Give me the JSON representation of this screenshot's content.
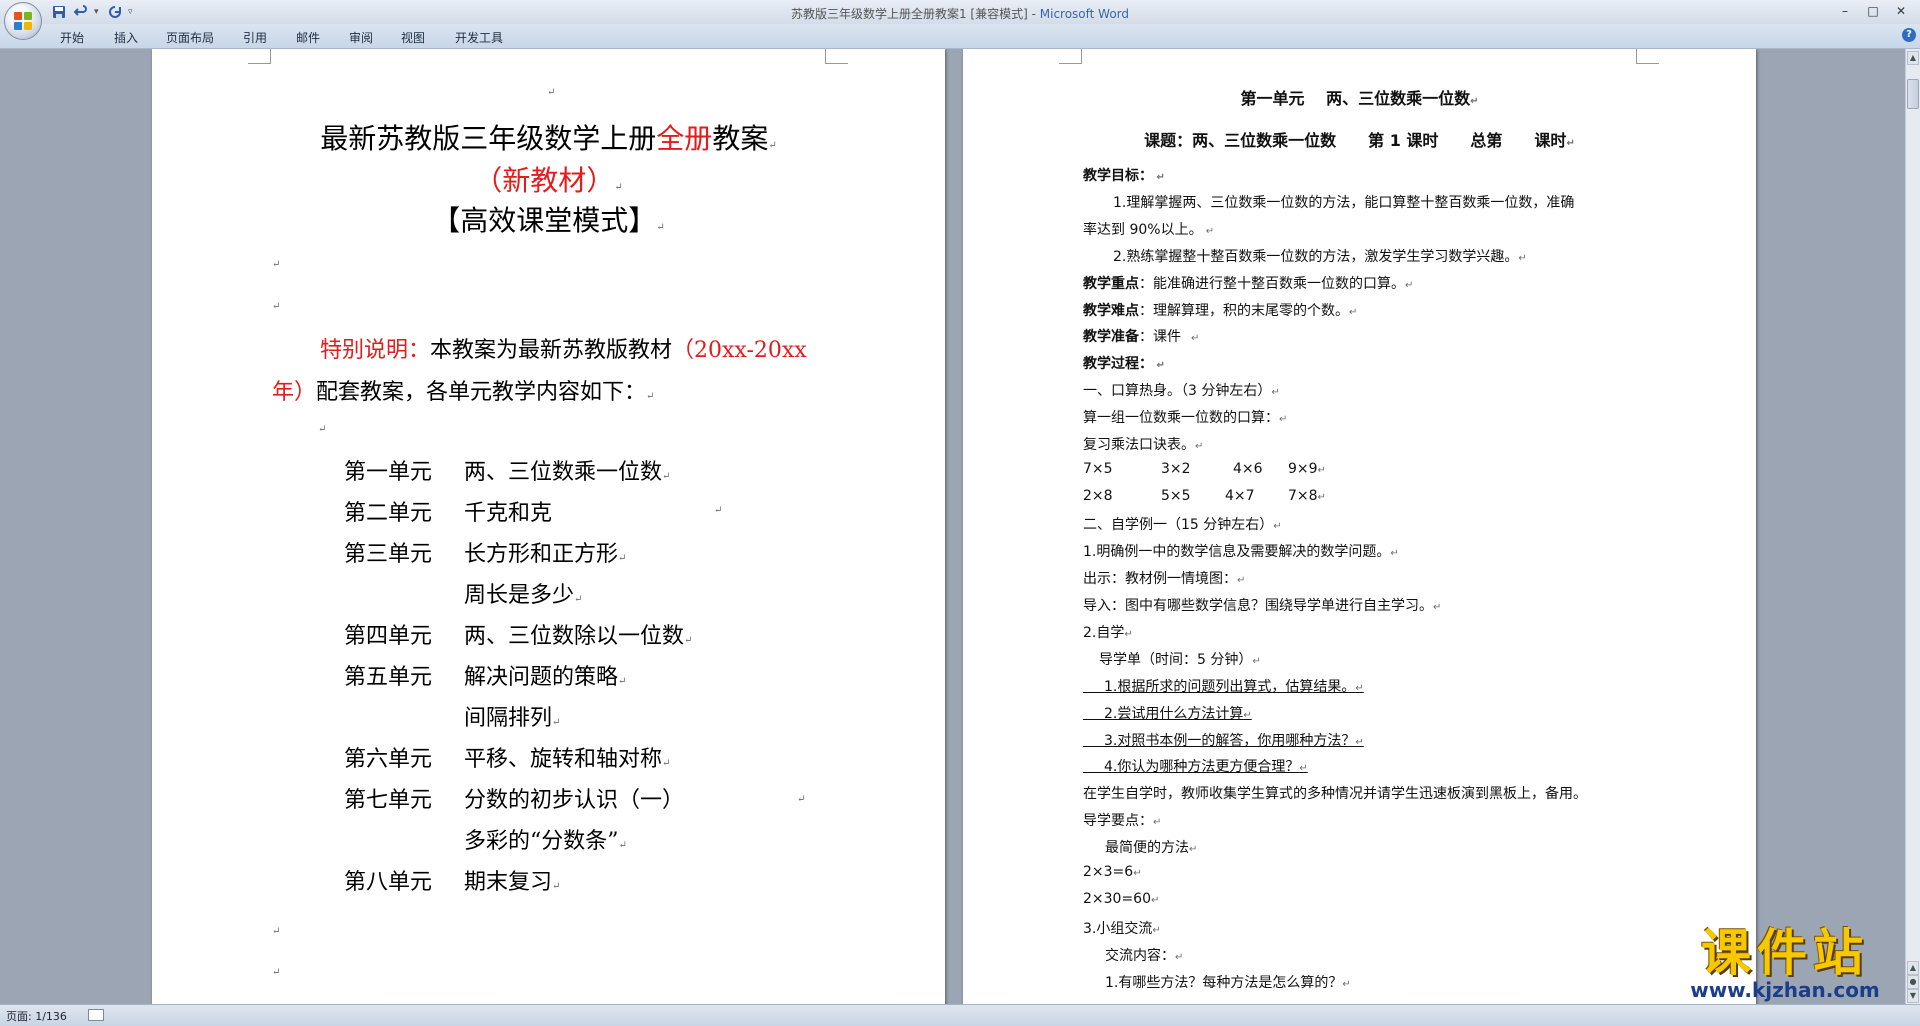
{
  "window": {
    "title_doc": "苏教版三年级数学上册全册教案1 [兼容模式] - ",
    "title_app": "Microsoft Word",
    "minimize": "–",
    "maximize": "□",
    "close": "✕"
  },
  "qat": {
    "save_icon": "save-icon",
    "undo_icon": "undo-icon",
    "redo_icon": "redo-icon",
    "customize_icon": "customize-icon"
  },
  "ribbon": {
    "tabs": [
      "开始",
      "插入",
      "页面布局",
      "引用",
      "邮件",
      "审阅",
      "视图",
      "开发工具"
    ]
  },
  "page1": {
    "title_a": "最新苏教版三年级数学上册",
    "title_red": "全册",
    "title_b": "教案",
    "subtitle_open": "（",
    "subtitle": "新教材",
    "subtitle_close": "）",
    "mode": "【高效课堂模式】",
    "note_label": "特别说明：",
    "note_text": "本教案为最新苏教版教材",
    "note_years": "（20xx-20xx",
    "note_years2": "年）",
    "note_text2": "配套教案，各单元教学内容如下：",
    "units": [
      {
        "no": "第一单元",
        "topic": "两、三位数乘一位数"
      },
      {
        "no": "第二单元",
        "topic": "千克和克"
      },
      {
        "no": "第三单元",
        "topic": "长方形和正方形"
      },
      {
        "no": "",
        "topic": "周长是多少"
      },
      {
        "no": "第四单元",
        "topic": "两、三位数除以一位数"
      },
      {
        "no": "第五单元",
        "topic": "解决问题的策略"
      },
      {
        "no": "",
        "topic": "间隔排列"
      },
      {
        "no": "第六单元",
        "topic": "平移、旋转和轴对称"
      },
      {
        "no": "第七单元",
        "topic": "分数的初步认识（一）"
      },
      {
        "no": "",
        "topic": "多彩的“分数条”"
      },
      {
        "no": "第八单元",
        "topic": "期末复习"
      }
    ]
  },
  "page2": {
    "heading": "第一单元　 两、三位数乘一位数",
    "lesson": "课题：两、三位数乘一位数　　第 1 课时　　总第　　课时",
    "goal_label": "教学目标：",
    "goal1a": "1.理解掌握两、三位数乘一位数的方法，能口算整十整百数乘一位数，准确",
    "goal1b": "率达到 90%以上。",
    "goal2": "2.熟练掌握整十整百数乘一位数的方法，激发学生学习数学兴趣。",
    "key_label": "教学重点",
    "key_text": "：能准确进行整十整百数乘一位数的口算。",
    "diff_label": "教学难点",
    "diff_text": "：理解算理，积的末尾零的个数。",
    "prep_label": "教学准备",
    "prep_text": "：课件",
    "proc_label": "教学过程：",
    "s1": "一、口算热身。（3 分钟左右）",
    "s1a": "算一组一位数乘一位数的口算：",
    "s1b": "复习乘法口诀表。",
    "calc_row1": [
      " 7×5",
      "3×2",
      "4×6",
      "9×9"
    ],
    "calc_row2": [
      " 2×8",
      "5×5",
      "4×7",
      "7×8"
    ],
    "s2": "二、自学例一（15 分钟左右）",
    "s2a": "1.明确例一中的数学信息及需要解决的数学问题。",
    "s2b": "出示：教材例一情境图：",
    "s2c": "导入：图中有哪些数学信息？围绕导学单进行自主学习。",
    "s2d": "2.自学",
    "s2e": "导学单（时间：5 分钟）",
    "q1": "1.根据所求的问题列出算式，估算结果。",
    "q2": "2.尝试用什么方法计算",
    "q3": "3.对照书本例一的解答，你用哪种方法？",
    "q4": "4.你认为哪种方法更方便合理？",
    "s2f": "在学生自学时，教师收集学生算式的多种情况并请学生迅速板演到黑板上，备用。",
    "s2g": "导学要点：",
    "s2h": "最简便的方法",
    "eq1": "2×3=6",
    "eq2": "2×30=60",
    "s3": "3.小组交流",
    "s3a": "交流内容：",
    "s3b": "1.有哪些方法？每种方法是怎么算的？"
  },
  "status": {
    "page": "页面: 1/136"
  },
  "watermark": {
    "cn": "课件站",
    "en": "www.kjzhan.com"
  },
  "colors": {
    "accent_red": "#e31b1b",
    "workspace": "#9ba5b3",
    "ribbon": "#c8d6e8"
  }
}
